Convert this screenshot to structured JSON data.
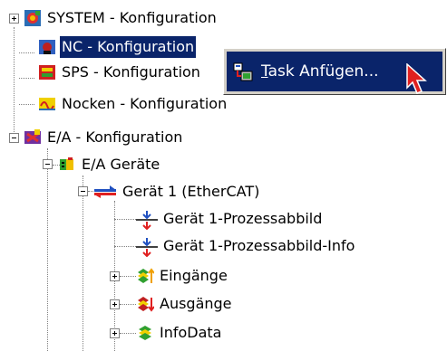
{
  "tree": {
    "items": [
      {
        "label": "SYSTEM - Konfiguration",
        "icon": "system-config-icon"
      },
      {
        "label": "NC - Konfiguration",
        "icon": "nc-config-icon",
        "selected": true
      },
      {
        "label": "SPS - Konfiguration",
        "icon": "plc-config-icon"
      },
      {
        "label": "Nocken - Konfiguration",
        "icon": "cam-config-icon"
      },
      {
        "label": "E/A - Konfiguration",
        "icon": "io-config-icon"
      },
      {
        "label": "E/A Geräte",
        "icon": "io-devices-icon"
      },
      {
        "label": "Gerät 1 (EtherCAT)",
        "icon": "ethercat-device-icon"
      },
      {
        "label": "Gerät 1-Prozessabbild",
        "icon": "process-image-icon"
      },
      {
        "label": "Gerät 1-Prozessabbild-Info",
        "icon": "process-image-info-icon"
      },
      {
        "label": "Eingänge",
        "icon": "inputs-icon"
      },
      {
        "label": "Ausgänge",
        "icon": "outputs-icon"
      },
      {
        "label": "InfoData",
        "icon": "infodata-icon"
      }
    ]
  },
  "context_menu": {
    "item_accel": "T",
    "item_rest": "ask Anfügen...",
    "icon": "task-add-icon"
  },
  "colors": {
    "selection": "#0a246a",
    "menu_bg": "#d4d0c8"
  }
}
